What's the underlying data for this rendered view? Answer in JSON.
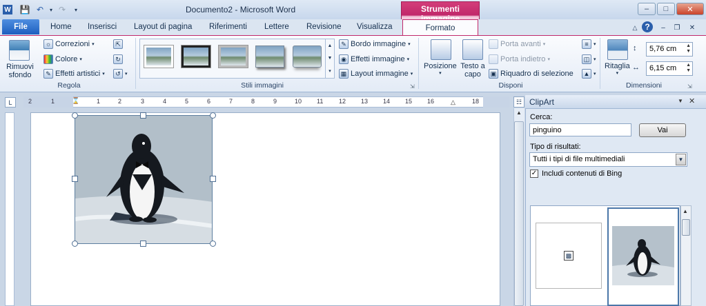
{
  "window": {
    "title": "Documento2 - Microsoft Word",
    "context_tab_title": "Strumenti immagine"
  },
  "tabs": [
    "File",
    "Home",
    "Inserisci",
    "Layout di pagina",
    "Riferimenti",
    "Lettere",
    "Revisione",
    "Visualizza",
    "Formato"
  ],
  "ribbon": {
    "regola": {
      "label": "Regola",
      "remove_bg": "Rimuovi sfondo",
      "corrections": "Correzioni",
      "color": "Colore",
      "artistic": "Effetti artistici"
    },
    "stili": {
      "label": "Stili immagini",
      "border": "Bordo immagine",
      "effects": "Effetti immagine",
      "layout": "Layout immagine"
    },
    "disponi": {
      "label": "Disponi",
      "position": "Posizione",
      "wrap": "Testo a capo",
      "bring_forward": "Porta avanti",
      "send_backward": "Porta indietro",
      "selection_pane": "Riquadro di selezione"
    },
    "dimensioni": {
      "label": "Dimensioni",
      "crop": "Ritaglia",
      "height": "5,76 cm",
      "width": "6,15 cm"
    }
  },
  "ruler": {
    "labels": [
      "2",
      "1",
      "1",
      "2",
      "3",
      "4",
      "5",
      "6",
      "7",
      "8",
      "9",
      "10",
      "11",
      "12",
      "13",
      "14",
      "15",
      "16",
      "18"
    ]
  },
  "clipart": {
    "title": "ClipArt",
    "search_label": "Cerca:",
    "search_value": "pinguino",
    "go_label": "Vai",
    "type_label": "Tipo di risultati:",
    "type_value": "Tutti i tipi di file multimediali",
    "bing_label": "Includi contenuti di Bing",
    "bing_checked": true
  },
  "colors": {
    "file_tab": "#1d5fbf",
    "context_accent": "#c1286a"
  }
}
